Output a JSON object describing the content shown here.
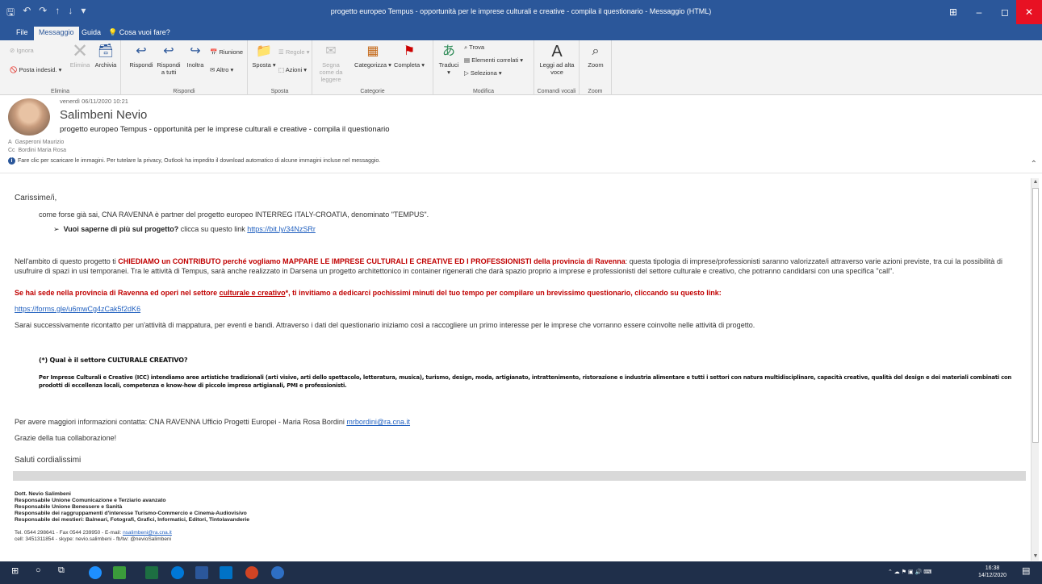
{
  "window": {
    "title": "progetto europeo Tempus - opportunità per le imprese culturali e creative - compila il questionario - Messaggio (HTML)",
    "controls": [
      "⊞",
      "–",
      "◻",
      "✕"
    ]
  },
  "tabs": [
    {
      "label": "File"
    },
    {
      "label": "Messaggio"
    },
    {
      "label": "Guida"
    },
    {
      "label": "Cosa vuoi fare?"
    }
  ],
  "ribbon": {
    "elimina": {
      "ignora": "Ignora",
      "posta_indesiderata": "Posta indesid.",
      "elimina": "Elimina",
      "archivia": "Archivia",
      "label": "Elimina"
    },
    "rispondi": {
      "rispondi": "Rispondi",
      "rispondi_tutti": "Rispondi a tutti",
      "inoltra": "Inoltra",
      "riunione": "Riunione",
      "altro": "Altro",
      "label": "Rispondi"
    },
    "sposta": {
      "regole": "Regole",
      "sposta": "Sposta",
      "azioni": "Azioni",
      "label": "Sposta"
    },
    "categorie": {
      "segna_letto": "Segna come da leggere",
      "categorizza": "Categorizza",
      "completa": "Completa",
      "label": "Categorie"
    },
    "modifica": {
      "traduci": "Traduci",
      "trova": "Trova",
      "elementi_correlati": "Elementi correlati",
      "seleziona": "Seleziona",
      "label": "Modifica"
    },
    "comandi_vocali": {
      "leggi": "Leggi ad alta voce",
      "label": "Comandi vocali"
    },
    "zoom": {
      "zoom": "Zoom",
      "label": "Zoom"
    }
  },
  "header": {
    "date": "venerdì 06/11/2020 10:21",
    "sender": "Salimbeni Nevio",
    "subject": "progetto europeo Tempus - opportunità per le imprese culturali e creative - compila il questionario",
    "to_label": "A",
    "to": "Gasperoni Maurizio",
    "cc_label": "Cc",
    "cc": "Bordini Maria Rosa",
    "info": "Fare clic per scaricare le immagini. Per tutelare la privacy, Outlook ha impedito il download automatico di alcune immagini incluse nel messaggio."
  },
  "body": {
    "greeting": "Carissime/i,",
    "intro": "come forse già sai, CNA RAVENNA è partner  del progetto europeo INTERREG ITALY-CROATIA, denominato \"TEMPUS\".",
    "bullet_bold": "Vuoi saperne di più sul progetto?",
    "bullet_text": " clicca su questo link ",
    "bullet_link": "https://bit.ly/34NzSRr",
    "p1_a": "Nell'ambito di questo progetto ti ",
    "p1_red": "CHIEDIAMO un CONTRIBUTO perché vogliamo MAPPARE LE IMPRESE CULTURALI E CREATIVE ED I PROFESSIONISTI  della provincia di Ravenna",
    "p1_b": ":  questa tipologia di imprese/professionisti saranno valorizzate/i attraverso varie azioni previste, tra cui la possibilità di usufruire di spazi in usi temporanei. Tra le attività di Tempus, sarà anche realizzato in Darsena un progetto architettonico in container rigenerati che darà spazio proprio a imprese e professionisti del settore culturale e creativo, che potranno candidarsi con una specifica \"call\".",
    "p2_a": "Se hai sede nella provincia di Ravenna ed operi nel settore ",
    "p2_u": "culturale e creativo",
    "p2_b": "*, ti invitiamo a dedicarci pochissimi minuti del tuo tempo per compilare un brevissimo questionario, cliccando su questo link:",
    "form_link": "https://forms.gle/u6mwCg4zCak5f2dK6",
    "p3": "Sarai successivamente ricontatto per un'attività di mappatura, per eventi e bandi. Attraverso i dati del questionario iniziamo così a raccogliere un primo interesse per le imprese che vorranno essere coinvolte nelle attività di progetto.",
    "def_title": "(*) Qual è il settore CULTURALE CREATIVO?",
    "def_text": "Per Imprese Culturali e Creative (ICC) intendiamo aree artistiche tradizionali (arti visive, arti dello spettacolo, letteratura, musica), turismo, design, moda, artigianato, intrattenimento, ristorazione e industria alimentare e tutti i settori con natura multidisciplinare, capacità creative, qualità del design e dei materiali combinati con prodotti di eccellenza locali, competenza e know-how di piccole imprese artigianali, PMI e professionisti.",
    "contact": "Per avere maggiori informazioni contatta: CNA RAVENNA Ufficio Progetti Europei - Maria Rosa Bordini ",
    "contact_email": "mrbordini@ra.cna.it",
    "thanks": "Grazie della tua collaborazione!",
    "regards": "Saluti cordialissimi"
  },
  "signature": {
    "lines": [
      "Dott. Nevio Salimbeni",
      "Responsabile Unione Comunicazione e Terziario avanzato",
      "Responsabile Unione Benessere e Sanità",
      "Responsabile dei raggruppamenti d'interesse Turismo-Commercio e Cinema-Audiovisivo",
      "Responsabile dei mestieri: Balneari, Fotografi, Grafici, Informatici, Editori, Tintolavanderie"
    ],
    "tel_a": "Tel. 0544 298641 - Fax 0544 239950 - E-mail: ",
    "tel_email": "nsalimbeni@ra.cna.it",
    "cell": "cell: 3451311854 - skype: nevio.salimbeni - fb/tw: @nevioSalimbeni"
  },
  "taskbar": {
    "time": "16:38",
    "date": "14/12/2020"
  },
  "colors": {
    "accent": "#2b579a",
    "red_text": "#c00000",
    "link": "#1f5fbf",
    "taskbar": "#1f2f4a"
  }
}
